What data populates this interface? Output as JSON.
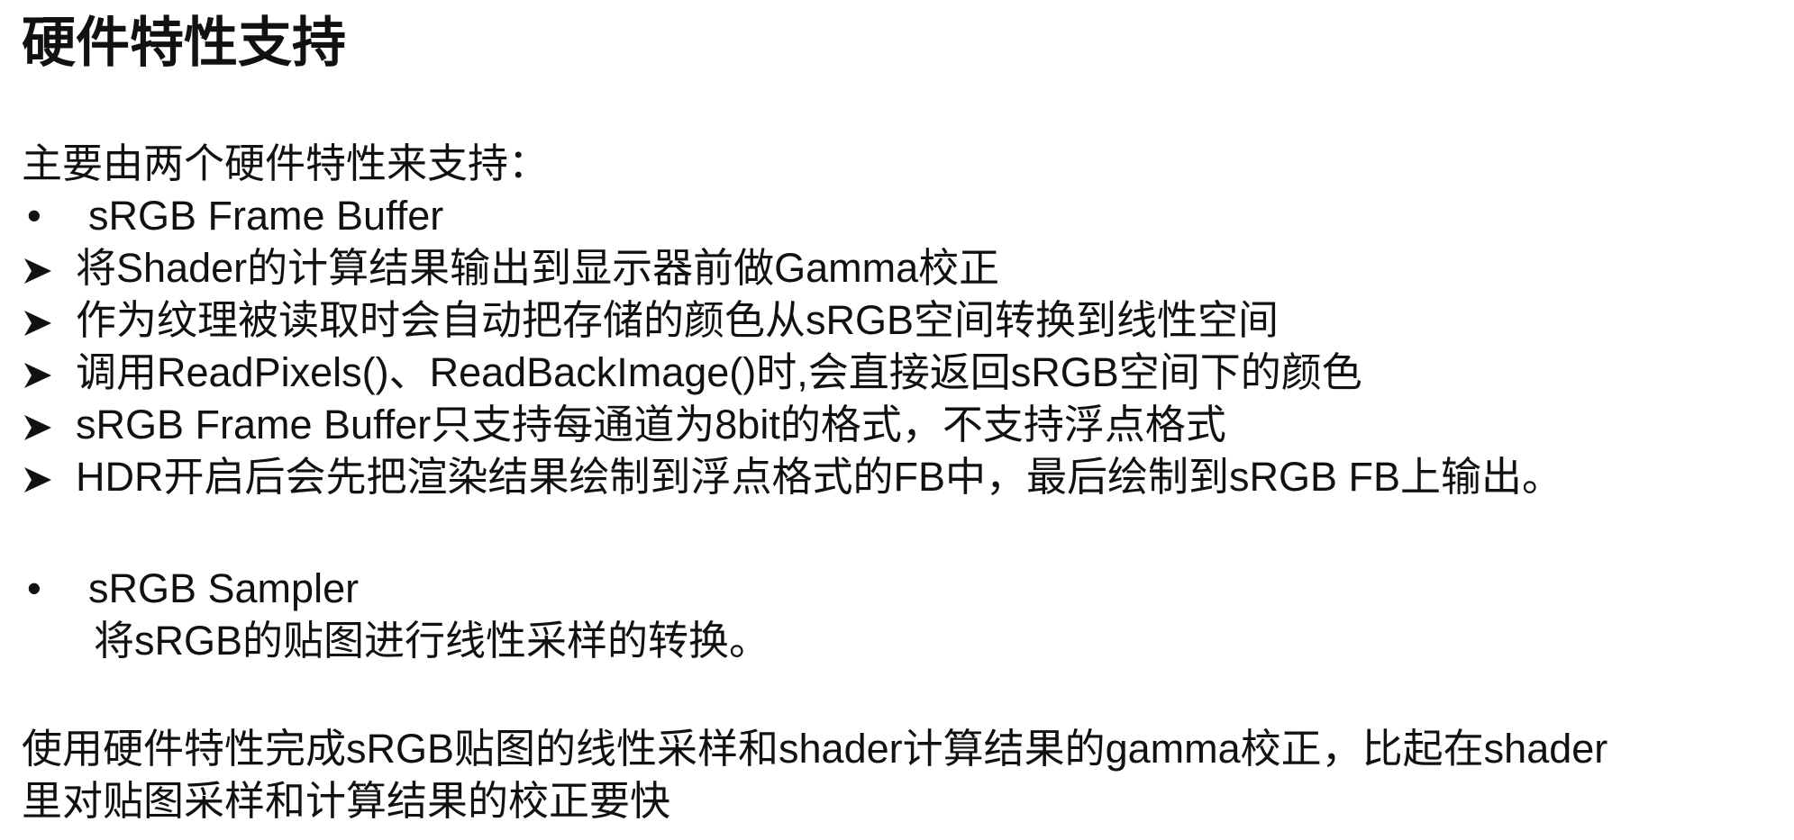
{
  "title": "硬件特性支持",
  "intro": "主要由两个硬件特性来支持：",
  "section1": {
    "heading": "sRGB Frame Buffer",
    "items": [
      "将Shader的计算结果输出到显示器前做Gamma校正",
      "作为纹理被读取时会自动把存储的颜色从sRGB空间转换到线性空间",
      "调用ReadPixels()、ReadBackImage()时,会直接返回sRGB空间下的颜色",
      "sRGB Frame Buffer只支持每通道为8bit的格式，不支持浮点格式",
      "HDR开启后会先把渲染结果绘制到浮点格式的FB中，最后绘制到sRGB FB上输出。"
    ]
  },
  "section2": {
    "heading": "sRGB Sampler",
    "description": "将sRGB的贴图进行线性采样的转换。"
  },
  "conclusion": {
    "line1": "使用硬件特性完成sRGB贴图的线性采样和shader计算结果的gamma校正，比起在shader",
    "line2": "里对贴图采样和计算结果的校正要快"
  },
  "bullet_icon": "bullet-dot-icon",
  "arrow_icon": "arrowhead-bullet-icon"
}
